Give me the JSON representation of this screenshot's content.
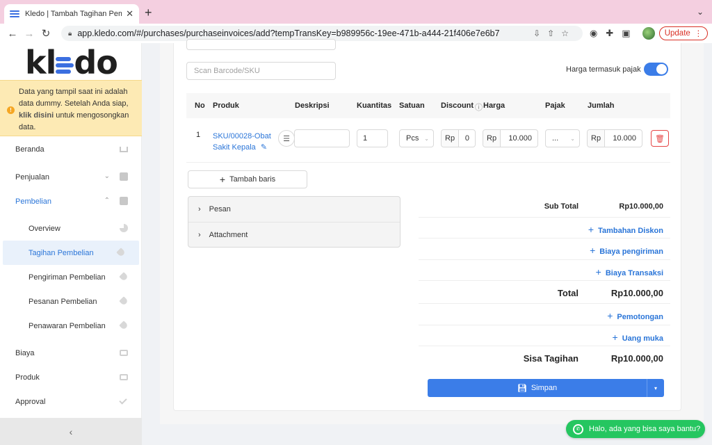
{
  "browser": {
    "tab_title": "Kledo | Tambah Tagihan Pembelian",
    "url": "app.kledo.com/#/purchases/purchaseinvoices/add?tempTransKey=b989956c-19ee-471b-a444-21f406e7e6b7",
    "update_label": "Update"
  },
  "sidebar": {
    "logo_prefix": "kl",
    "logo_suffix": "do",
    "notice_text_1": "Data yang tampil saat ini adalah data dummy. Setelah Anda siap,",
    "notice_link": "klik disini",
    "notice_text_2": "untuk mengosongkan data.",
    "items": {
      "beranda": "Beranda",
      "penjualan": "Penjualan",
      "pembelian": "Pembelian",
      "overview": "Overview",
      "tagihan": "Tagihan Pembelian",
      "pengiriman": "Pengiriman Pembelian",
      "pesanan": "Pesanan Pembelian",
      "penawaran": "Penawaran Pembelian",
      "biaya": "Biaya",
      "produk": "Produk",
      "approval": "Approval"
    }
  },
  "form": {
    "scan_placeholder": "Scan Barcode/SKU",
    "tax_toggle_label": "Harga termasuk pajak",
    "tax_toggle_on": true
  },
  "table": {
    "headers": {
      "no": "No",
      "produk": "Produk",
      "deskripsi": "Deskripsi",
      "kuantitas": "Kuantitas",
      "satuan": "Satuan",
      "discount": "Discount",
      "harga": "Harga",
      "pajak": "Pajak",
      "jumlah": "Jumlah"
    },
    "rows": [
      {
        "no": "1",
        "product": "SKU/00028-Obat Sakit Kepala",
        "description": "",
        "quantity": "1",
        "unit": "Pcs",
        "discount_prefix": "Rp",
        "discount": "0",
        "price_prefix": "Rp",
        "price": "10.000",
        "tax": "...",
        "total_prefix": "Rp",
        "total": "10.000"
      }
    ],
    "add_row_label": "Tambah baris"
  },
  "collapses": {
    "pesan": "Pesan",
    "attachment": "Attachment"
  },
  "summary": {
    "subtotal_label": "Sub Total",
    "subtotal": "Rp10.000,00",
    "diskon_link": "Tambahan Diskon",
    "pengiriman_link": "Biaya pengiriman",
    "transaksi_link": "Biaya Transaksi",
    "total_label": "Total",
    "total": "Rp10.000,00",
    "pemotongan_link": "Pemotongan",
    "uang_muka_link": "Uang muka",
    "sisa_label": "Sisa Tagihan",
    "sisa": "Rp10.000,00"
  },
  "actions": {
    "save_label": "Simpan"
  },
  "chat": {
    "label": "Halo, ada yang bisa saya bantu?"
  },
  "colors": {
    "primary": "#3b7de8",
    "link": "#2a75d8",
    "danger": "#e64545",
    "whatsapp": "#25c660",
    "notice_bg": "#fdeab4"
  }
}
